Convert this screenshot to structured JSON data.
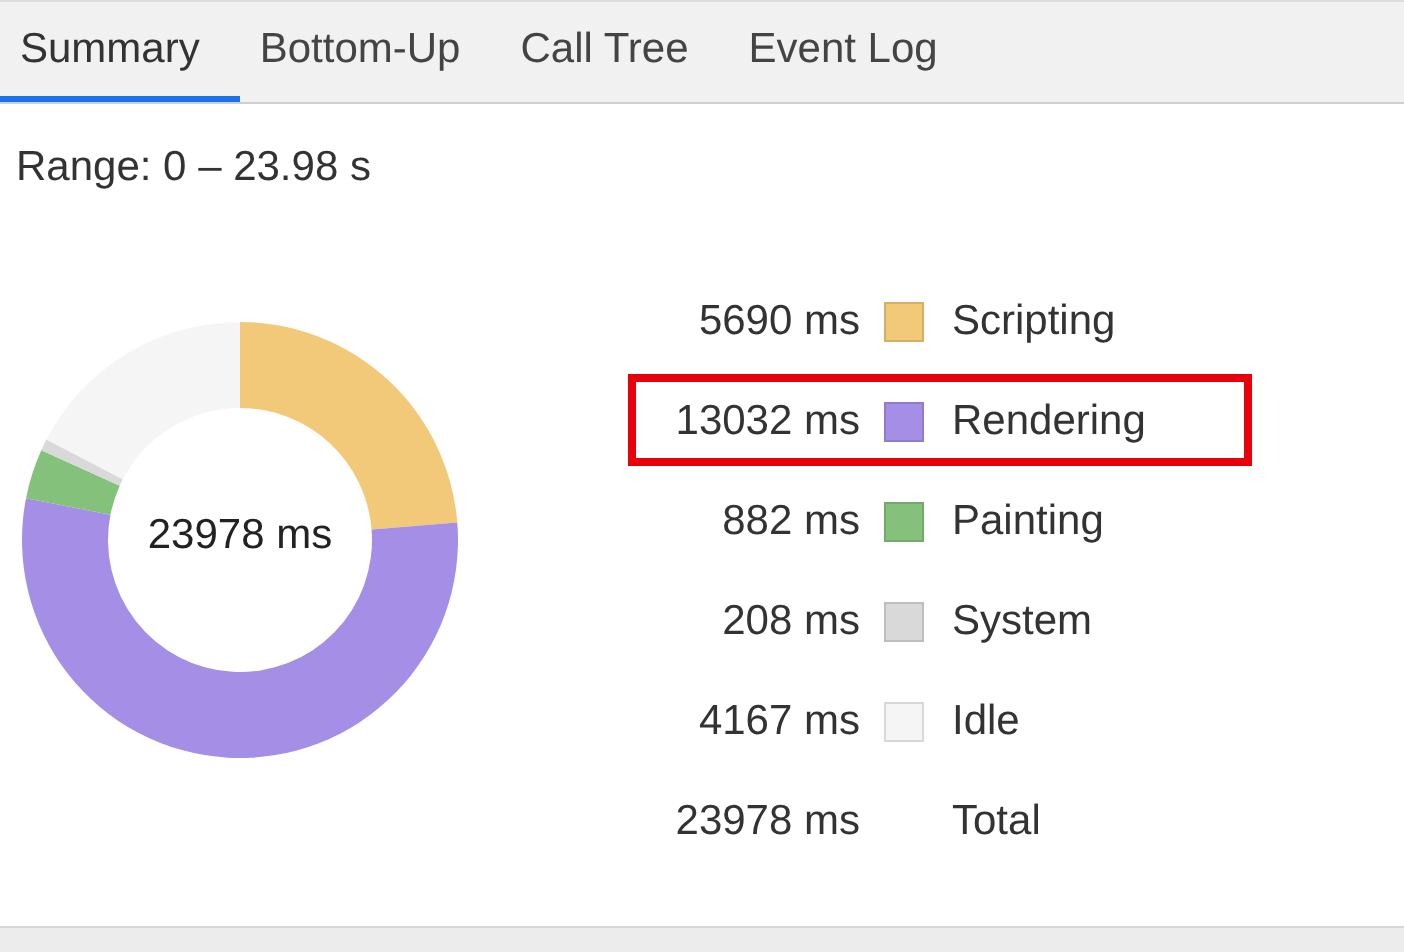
{
  "tabs": [
    {
      "label": "Summary",
      "selected": true
    },
    {
      "label": "Bottom-Up",
      "selected": false
    },
    {
      "label": "Call Tree",
      "selected": false
    },
    {
      "label": "Event Log",
      "selected": false
    }
  ],
  "range": "Range: 0 – 23.98 s",
  "chart": {
    "center_label": "23978 ms",
    "chart_data": {
      "type": "donut",
      "categories": [
        "Scripting",
        "Rendering",
        "Painting",
        "System",
        "Idle"
      ],
      "values": [
        23.73,
        54.34,
        3.68,
        0.87,
        17.38
      ]
    }
  },
  "legend": [
    {
      "kind": "category",
      "value": "5690 ms",
      "color": "#f2c879",
      "highlighted": false
    },
    {
      "kind": "category",
      "value": "13032 ms",
      "color": "#a48ee6",
      "highlighted": true
    },
    {
      "kind": "category",
      "value": "882 ms",
      "color": "#84c17a",
      "highlighted": false
    },
    {
      "kind": "category",
      "value": "208 ms",
      "color": "#d9d9d9",
      "highlighted": false
    },
    {
      "kind": "category",
      "value": "4167 ms",
      "color": "#f5f5f5",
      "highlighted": false
    },
    {
      "kind": "total",
      "value": "23978 ms",
      "label": "Total",
      "highlighted": false
    }
  ]
}
